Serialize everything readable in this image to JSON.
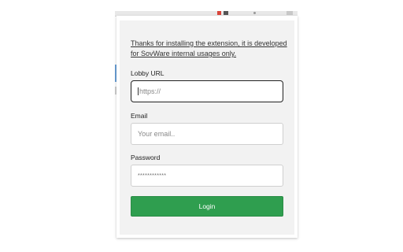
{
  "intro_text": "Thanks for installing the extension, it is developed for SovWare internal usages only.",
  "lobby": {
    "label": "Lobby URL",
    "placeholder": "https://"
  },
  "email": {
    "label": "Email",
    "placeholder": "Your email.."
  },
  "password": {
    "label": "Password",
    "masked_value": "************"
  },
  "login_button": {
    "label": "Login"
  },
  "colors": {
    "button_green": "#2f9e4f",
    "panel_bg": "#f2f2f2"
  }
}
